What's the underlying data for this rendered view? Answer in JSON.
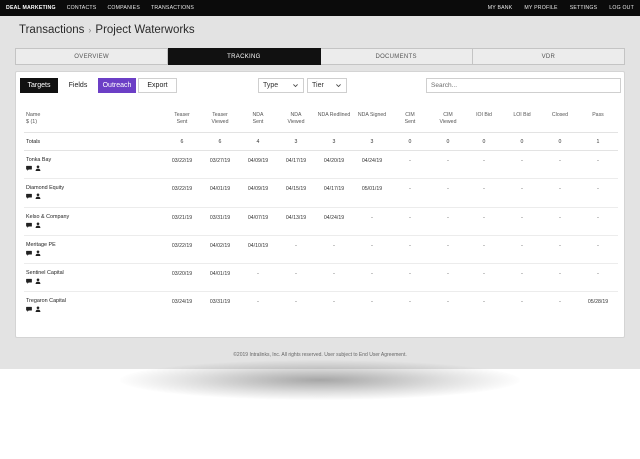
{
  "topnav": {
    "brand": "DEAL MARKETING",
    "left_items": [
      "CONTACTS",
      "COMPANIES",
      "TRANSACTIONS"
    ],
    "right_items": [
      "MY BANK",
      "MY PROFILE",
      "SETTINGS",
      "LOG OUT"
    ]
  },
  "breadcrumb": {
    "parent": "Transactions",
    "separator": "›",
    "current": "Project Waterworks"
  },
  "tabs": [
    "OVERVIEW",
    "TRACKING",
    "DOCUMENTS",
    "VDR"
  ],
  "active_tab": "TRACKING",
  "toolbar": {
    "targets": "Targets",
    "fields": "Fields",
    "outreach": "Outreach",
    "export": "Export"
  },
  "filters": {
    "type": "Type",
    "tier": "Tier",
    "search_placeholder": "Search..."
  },
  "table": {
    "name_header": [
      "Name",
      "$ (1)"
    ],
    "columns": [
      [
        "Teaser",
        "Sent"
      ],
      [
        "Teaser",
        "Viewed"
      ],
      [
        "NDA",
        "Sent"
      ],
      [
        "NDA",
        "Viewed"
      ],
      [
        "NDA Redlined"
      ],
      [
        "NDA Signed"
      ],
      [
        "CIM",
        "Sent"
      ],
      [
        "CIM",
        "Viewed"
      ],
      [
        "IOI Bid"
      ],
      [
        "LOI Bid"
      ],
      [
        "Closed"
      ],
      [
        "Pass"
      ]
    ],
    "totals_label": "Totals",
    "totals": [
      "6",
      "6",
      "4",
      "3",
      "3",
      "3",
      "0",
      "0",
      "0",
      "0",
      "0",
      "1"
    ],
    "rows": [
      {
        "name": "Tonka Bay",
        "values": [
          "03/22/19",
          "03/27/19",
          "04/09/19",
          "04/17/19",
          "04/20/19",
          "04/24/19",
          "-",
          "-",
          "-",
          "-",
          "-",
          "-"
        ]
      },
      {
        "name": "Diamond Equity",
        "values": [
          "03/22/19",
          "04/01/19",
          "04/09/19",
          "04/15/19",
          "04/17/19",
          "05/01/19",
          "-",
          "-",
          "-",
          "-",
          "-",
          "-"
        ]
      },
      {
        "name": "Kelso & Company",
        "values": [
          "03/21/19",
          "03/31/19",
          "04/07/19",
          "04/13/19",
          "04/24/19",
          "-",
          "-",
          "-",
          "-",
          "-",
          "-",
          "-"
        ]
      },
      {
        "name": "Meritage PE",
        "values": [
          "03/22/19",
          "04/02/19",
          "04/10/19",
          "-",
          "-",
          "-",
          "-",
          "-",
          "-",
          "-",
          "-",
          "-"
        ]
      },
      {
        "name": "Sentinel Capital",
        "values": [
          "03/20/19",
          "04/01/19",
          "-",
          "-",
          "-",
          "-",
          "-",
          "-",
          "-",
          "-",
          "-",
          "-"
        ]
      },
      {
        "name": "Tregaron Capital",
        "values": [
          "03/24/19",
          "03/31/19",
          "-",
          "-",
          "-",
          "-",
          "-",
          "-",
          "-",
          "-",
          "-",
          "05/28/19"
        ]
      }
    ]
  },
  "footer": "©2019 Intralinks, Inc. All rights reserved. User subject to End User Agreement.",
  "colors": {
    "accent": "#6c3fc6",
    "dark": "#111111",
    "background": "#e3e3e3"
  },
  "icons": {
    "row_icons": [
      "comment-icon",
      "person-icon"
    ]
  }
}
